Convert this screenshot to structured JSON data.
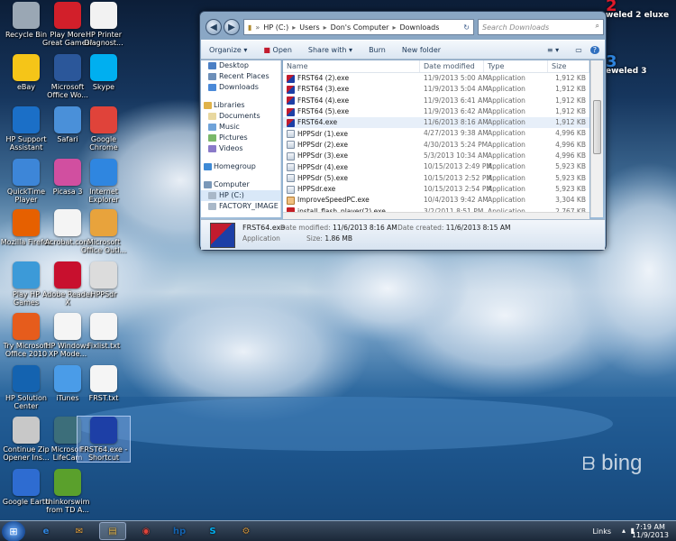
{
  "desktop": {
    "icons": [
      {
        "label": "Recycle Bin",
        "icon": "recycle-bin-icon",
        "color": "#9aa7b4"
      },
      {
        "label": "Play More Great Games!",
        "icon": "games-icon",
        "color": "#d21f2a"
      },
      {
        "label": "HP Printer Diagnost...",
        "icon": "printer-document-icon",
        "color": "#f2f2f2"
      },
      {
        "label": "eBay",
        "icon": "ebay-icon",
        "color": "#f5c518"
      },
      {
        "label": "Microsoft Office Wo...",
        "icon": "word-icon",
        "color": "#2b579a"
      },
      {
        "label": "Skype",
        "icon": "skype-icon",
        "color": "#00aff0"
      },
      {
        "label": "HP Support Assistant",
        "icon": "help-icon",
        "color": "#1b6fc7"
      },
      {
        "label": "Safari",
        "icon": "safari-icon",
        "color": "#4a90d9"
      },
      {
        "label": "Google Chrome",
        "icon": "chrome-icon",
        "color": "#e0433a"
      },
      {
        "label": "QuickTime Player",
        "icon": "quicktime-icon",
        "color": "#3d86d8"
      },
      {
        "label": "Picasa 3",
        "icon": "picasa-icon",
        "color": "#d14fa0"
      },
      {
        "label": "Internet Explorer",
        "icon": "internet-explorer-icon",
        "color": "#2f86e0"
      },
      {
        "label": "Mozilla Firefox",
        "icon": "firefox-icon",
        "color": "#e66000"
      },
      {
        "label": "Acrobat.com",
        "icon": "acrobat-com-icon",
        "color": "#f4f4f4"
      },
      {
        "label": "Microsoft Office Outl...",
        "icon": "outlook-icon",
        "color": "#e8a33c"
      },
      {
        "label": "Play HP Games",
        "icon": "hp-games-icon",
        "color": "#3c9ad8"
      },
      {
        "label": "Adobe Reader X",
        "icon": "adobe-reader-icon",
        "color": "#c8102e"
      },
      {
        "label": "HPPSdr",
        "icon": "hppsdr-icon",
        "color": "#dcdcdc"
      },
      {
        "label": "Try Microsoft Office 2010",
        "icon": "office-icon",
        "color": "#e65c1c"
      },
      {
        "label": "HP Windows XP Mode...",
        "icon": "document-icon",
        "color": "#f5f5f5"
      },
      {
        "label": "Fixlist.txt",
        "icon": "text-file-icon",
        "color": "#f5f5f5"
      },
      {
        "label": "HP Solution Center",
        "icon": "hp-icon",
        "color": "#1463b0"
      },
      {
        "label": "iTunes",
        "icon": "itunes-icon",
        "color": "#4a9ce8"
      },
      {
        "label": "FRST.txt",
        "icon": "text-file-icon",
        "color": "#f5f5f5"
      },
      {
        "label": "Continue Zip Opener Ins...",
        "icon": "zip-opener-icon",
        "color": "#c8c8c8"
      },
      {
        "label": "Microsoft LifeCam",
        "icon": "lifecam-icon",
        "color": "#3c6e7a"
      },
      {
        "label": "FRST64.exe - Shortcut",
        "icon": "frst-shortcut-icon",
        "color": "#1d3fa6"
      },
      {
        "label": "Google Earth",
        "icon": "google-earth-icon",
        "color": "#2e6cd1"
      },
      {
        "label": "thinkorswim from TD A...",
        "icon": "thinkorswim-icon",
        "color": "#5aa02c"
      }
    ],
    "edge_labels": [
      "weled 2 eluxe",
      "eweled 3"
    ],
    "watermark": "bing"
  },
  "explorer": {
    "nav_back": "◀",
    "nav_forward": "▶",
    "address": {
      "parts": [
        "HP (C:)",
        "Users",
        "Don's Computer",
        "Downloads"
      ],
      "refresh": "↻"
    },
    "search_placeholder": "Search Downloads",
    "toolbar": {
      "organize": "Organize ▾",
      "open": "Open",
      "share_with": "Share with ▾",
      "burn": "Burn",
      "new_folder": "New folder",
      "views": "≡ ▾",
      "preview": "▭",
      "help": "?"
    },
    "nav_pane": [
      {
        "label": "Desktop",
        "type": "item",
        "color": "#4b7fc4"
      },
      {
        "label": "Recent Places",
        "type": "item",
        "color": "#6d8fb9"
      },
      {
        "label": "Downloads",
        "type": "item",
        "color": "#4a89d8"
      },
      {
        "label": "",
        "type": "gap"
      },
      {
        "label": "Libraries",
        "type": "header",
        "color": "#e0b34a"
      },
      {
        "label": "Documents",
        "type": "item",
        "color": "#e8d8a0"
      },
      {
        "label": "Music",
        "type": "item",
        "color": "#6fa3d9"
      },
      {
        "label": "Pictures",
        "type": "item",
        "color": "#7ab86a"
      },
      {
        "label": "Videos",
        "type": "item",
        "color": "#8a7ac9"
      },
      {
        "label": "",
        "type": "gap"
      },
      {
        "label": "Homegroup",
        "type": "header",
        "color": "#3d8ad6"
      },
      {
        "label": "",
        "type": "gap"
      },
      {
        "label": "Computer",
        "type": "header",
        "color": "#7a98b8"
      },
      {
        "label": "HP (C:)",
        "type": "item",
        "color": "#a9b8c8",
        "selected": true
      },
      {
        "label": "FACTORY_IMAGE",
        "type": "item",
        "color": "#a9b8c8"
      }
    ],
    "columns": [
      "Name",
      "Date modified",
      "Type",
      "Size"
    ],
    "files": [
      {
        "name": "FRST64 (2).exe",
        "date": "11/9/2013 5:00 AM",
        "type": "Application",
        "size": "1,912 KB",
        "icon": "frst"
      },
      {
        "name": "FRST64 (3).exe",
        "date": "11/9/2013 5:04 AM",
        "type": "Application",
        "size": "1,912 KB",
        "icon": "frst"
      },
      {
        "name": "FRST64 (4).exe",
        "date": "11/9/2013 6:41 AM",
        "type": "Application",
        "size": "1,912 KB",
        "icon": "frst"
      },
      {
        "name": "FRST64 (5).exe",
        "date": "11/9/2013 6:42 AM",
        "type": "Application",
        "size": "1,912 KB",
        "icon": "frst"
      },
      {
        "name": "FRST64.exe",
        "date": "11/6/2013 8:16 AM",
        "type": "Application",
        "size": "1,912 KB",
        "icon": "frst",
        "selected": true
      },
      {
        "name": "HPPSdr (1).exe",
        "date": "4/27/2013 9:38 AM",
        "type": "Application",
        "size": "4,996 KB",
        "icon": "hpp"
      },
      {
        "name": "HPPSdr (2).exe",
        "date": "4/30/2013 5:24 PM",
        "type": "Application",
        "size": "4,996 KB",
        "icon": "hpp"
      },
      {
        "name": "HPPSdr (3).exe",
        "date": "5/3/2013 10:34 AM",
        "type": "Application",
        "size": "4,996 KB",
        "icon": "hpp"
      },
      {
        "name": "HPPSdr (4).exe",
        "date": "10/15/2013 2:49 PM",
        "type": "Application",
        "size": "5,923 KB",
        "icon": "hpp"
      },
      {
        "name": "HPPSdr (5).exe",
        "date": "10/15/2013 2:52 PM",
        "type": "Application",
        "size": "5,923 KB",
        "icon": "hpp"
      },
      {
        "name": "HPPSdr.exe",
        "date": "10/15/2013 2:54 PM",
        "type": "Application",
        "size": "5,923 KB",
        "icon": "hpp"
      },
      {
        "name": "ImproveSpeedPC.exe",
        "date": "10/4/2013 9:42 AM",
        "type": "Application",
        "size": "3,304 KB",
        "icon": "imp"
      },
      {
        "name": "install_flash_player(2).exe",
        "date": "3/2/2011 8:51 PM",
        "type": "Application",
        "size": "2,767 KB",
        "icon": "flash"
      }
    ],
    "details": {
      "name": "FRST64.exe",
      "kind": "Application",
      "date_modified_label": "Date modified:",
      "date_modified": "11/6/2013 8:16 AM",
      "date_created_label": "Date created:",
      "date_created": "11/6/2013 8:15 AM",
      "size_label": "Size:",
      "size": "1.86 MB"
    }
  },
  "taskbar": {
    "start": "⊞",
    "apps": [
      {
        "label": "e",
        "icon": "internet-explorer-icon",
        "color": "#2f86e0"
      },
      {
        "label": "✉",
        "icon": "outlook-icon",
        "color": "#e8a33c"
      },
      {
        "label": "▤",
        "icon": "windows-explorer-icon",
        "color": "#e0b34a",
        "active": true
      },
      {
        "label": "◉",
        "icon": "chrome-icon",
        "color": "#e0433a"
      },
      {
        "label": "hp",
        "icon": "hp-icon",
        "color": "#1463b0"
      },
      {
        "label": "S",
        "icon": "skype-icon",
        "color": "#00aff0"
      },
      {
        "label": "⚙",
        "icon": "paint-icon",
        "color": "#c98f3a"
      }
    ],
    "links": "Links",
    "time": "7:19 AM",
    "date": "11/9/2013"
  }
}
